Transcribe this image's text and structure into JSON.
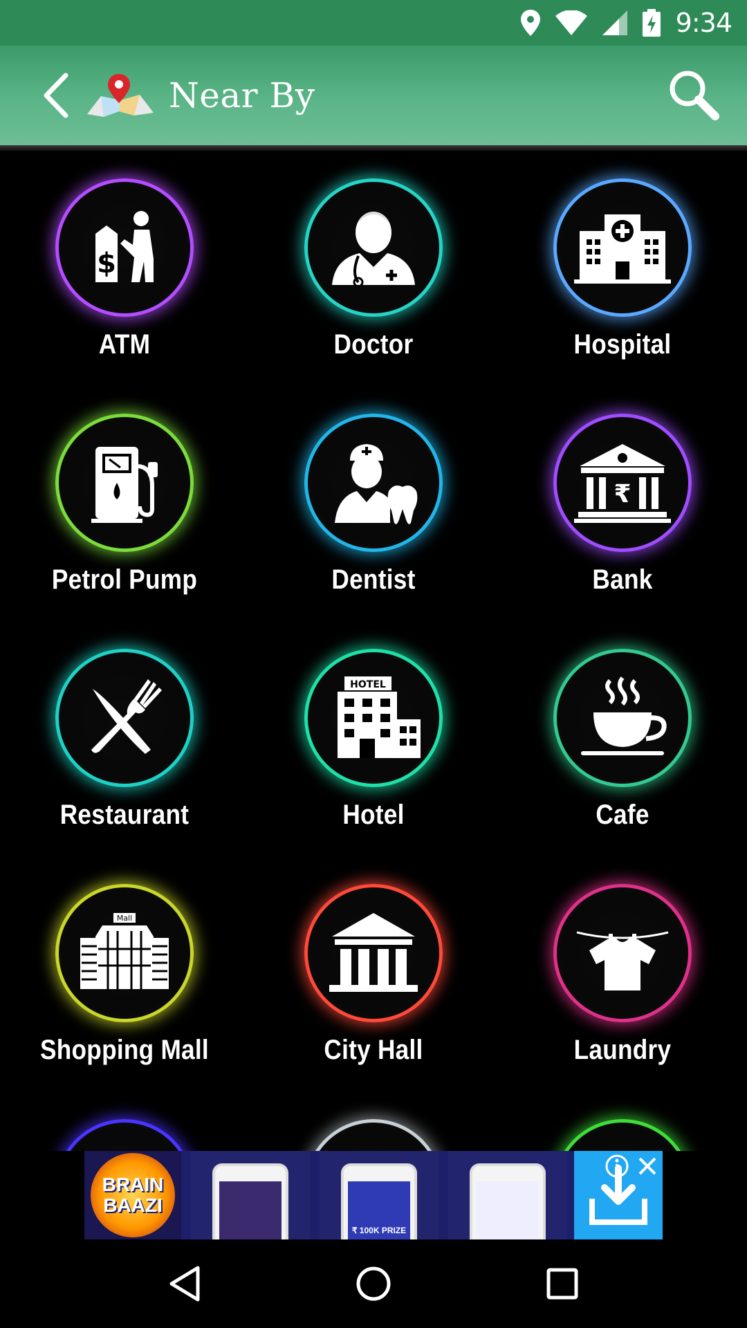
{
  "status_bar": {
    "time": "9:34",
    "icons": [
      "location-icon",
      "wifi-icon",
      "signal-icon",
      "battery-charging-icon"
    ]
  },
  "app_bar": {
    "title": "Near By",
    "back_icon": "chevron-left-icon",
    "logo_icon": "map-pin-logo-icon",
    "search_icon": "search-icon"
  },
  "categories": [
    {
      "label": "ATM",
      "icon": "atm-icon",
      "ring_color": "#b44dff"
    },
    {
      "label": "Doctor",
      "icon": "doctor-icon",
      "ring_color": "#26d4c6"
    },
    {
      "label": "Hospital",
      "icon": "hospital-icon",
      "ring_color": "#5aa9ff"
    },
    {
      "label": "Petrol Pump",
      "icon": "fuel-pump-icon",
      "ring_color": "#7cdc3c"
    },
    {
      "label": "Dentist",
      "icon": "dentist-icon",
      "ring_color": "#22b6e8"
    },
    {
      "label": "Bank",
      "icon": "bank-icon",
      "ring_color": "#9f4dff"
    },
    {
      "label": "Restaurant",
      "icon": "restaurant-icon",
      "ring_color": "#1fd1c4"
    },
    {
      "label": "Hotel",
      "icon": "hotel-icon",
      "ring_color": "#1ee0a8"
    },
    {
      "label": "Cafe",
      "icon": "coffee-cup-icon",
      "ring_color": "#33c98f"
    },
    {
      "label": "Shopping Mall",
      "icon": "mall-icon",
      "ring_color": "#c9d62a"
    },
    {
      "label": "City Hall",
      "icon": "city-hall-icon",
      "ring_color": "#ff4a3a"
    },
    {
      "label": "Laundry",
      "icon": "laundry-icon",
      "ring_color": "#e0318a"
    },
    {
      "label": "",
      "icon": "partial-icon",
      "ring_color": "#4b34ff"
    },
    {
      "label": "",
      "icon": "partial-icon",
      "ring_color": "#c8d0d6"
    },
    {
      "label": "",
      "icon": "partial-icon",
      "ring_color": "#3fdd3a"
    }
  ],
  "ad": {
    "logo_line1": "BRAIN",
    "logo_line2": "BAAZI",
    "phone_prize": "₹ 100K PRIZE",
    "download_icon": "download-icon",
    "choices_icon": "ad-choices-icon",
    "close_icon": "close-icon"
  },
  "nav_bar": {
    "icons": [
      "back-triangle-icon",
      "home-circle-icon",
      "recents-square-icon"
    ]
  }
}
